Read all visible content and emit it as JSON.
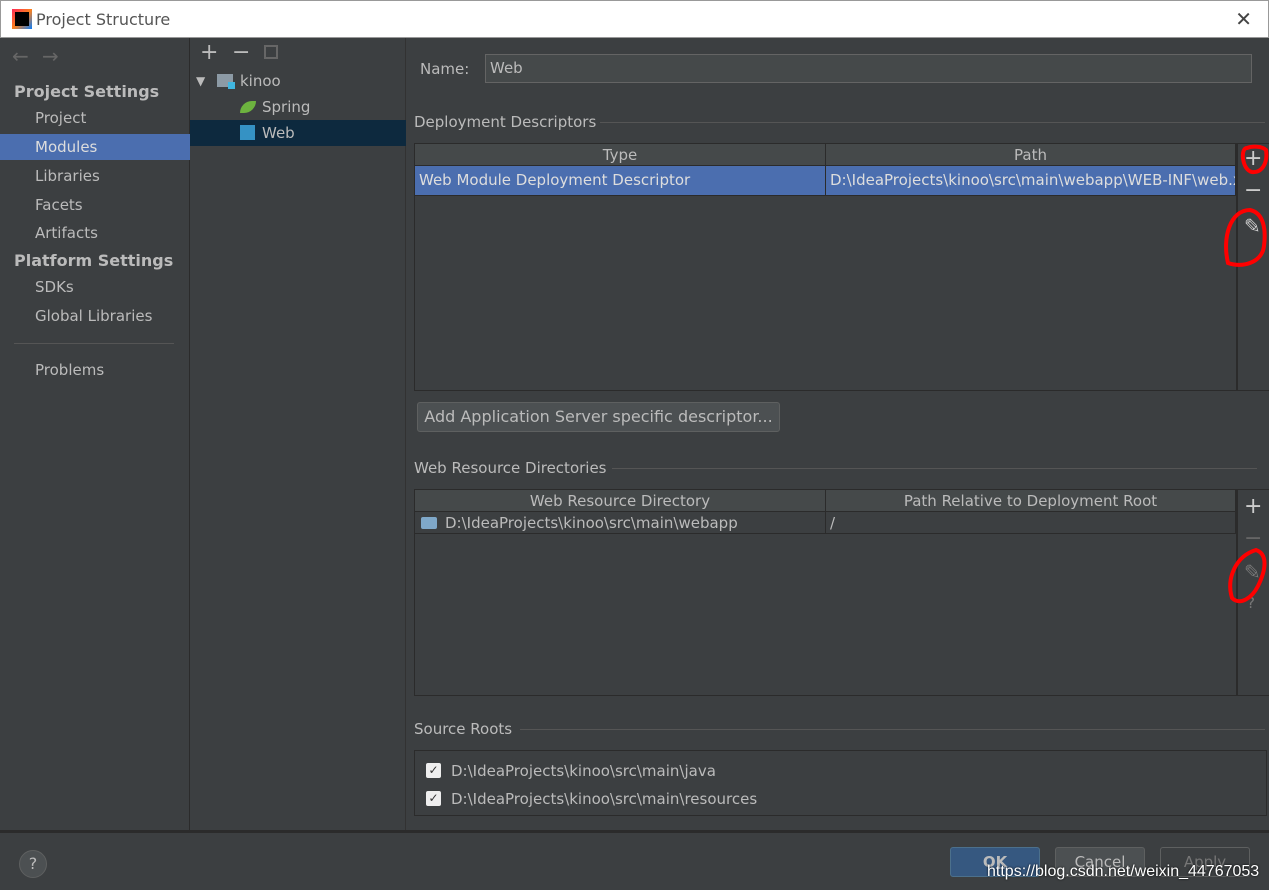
{
  "window": {
    "title": "Project Structure",
    "close": "✕"
  },
  "nav": {
    "back": "←",
    "forward": "→"
  },
  "sidebar": {
    "project_settings": "Project Settings",
    "items": [
      {
        "label": "Project"
      },
      {
        "label": "Modules"
      },
      {
        "label": "Libraries"
      },
      {
        "label": "Facets"
      },
      {
        "label": "Artifacts"
      }
    ],
    "platform_settings": "Platform Settings",
    "platform_items": [
      {
        "label": "SDKs"
      },
      {
        "label": "Global Libraries"
      }
    ],
    "problems": "Problems"
  },
  "tree": {
    "toolbar": {
      "add": "+",
      "remove": "−"
    },
    "root": "kinoo",
    "children": [
      {
        "label": "Spring"
      },
      {
        "label": "Web"
      }
    ]
  },
  "main": {
    "name_label": "Name:",
    "name_value": "Web",
    "deployment": {
      "title": "Deployment Descriptors",
      "headers": [
        "Type",
        "Path"
      ],
      "rows": [
        [
          "Web Module Deployment Descriptor",
          "D:\\IdeaProjects\\kinoo\\src\\main\\webapp\\WEB-INF\\web.xml"
        ]
      ]
    },
    "add_descriptor_button": "Add Application Server specific descriptor...",
    "web_resources": {
      "title": "Web Resource Directories",
      "headers": [
        "Web Resource Directory",
        "Path Relative to Deployment Root"
      ],
      "rows": [
        [
          "D:\\IdeaProjects\\kinoo\\src\\main\\webapp",
          "/"
        ]
      ]
    },
    "source_roots": {
      "title": "Source Roots",
      "items": [
        {
          "path": "D:\\IdeaProjects\\kinoo\\src\\main\\java",
          "checked": true
        },
        {
          "path": "D:\\IdeaProjects\\kinoo\\src\\main\\resources",
          "checked": true
        }
      ]
    }
  },
  "side_buttons": {
    "add": "+",
    "remove": "−",
    "edit": "✎",
    "help": "?"
  },
  "footer": {
    "help": "?",
    "ok": "OK",
    "cancel": "Cancel",
    "apply": "Apply"
  },
  "watermark": "https://blog.csdn.net/weixin_44767053",
  "colors": {
    "selection": "#4b6eaf",
    "tree_selection": "#0d293e",
    "annotation": "#ff0000",
    "ok_button": "#365880"
  }
}
